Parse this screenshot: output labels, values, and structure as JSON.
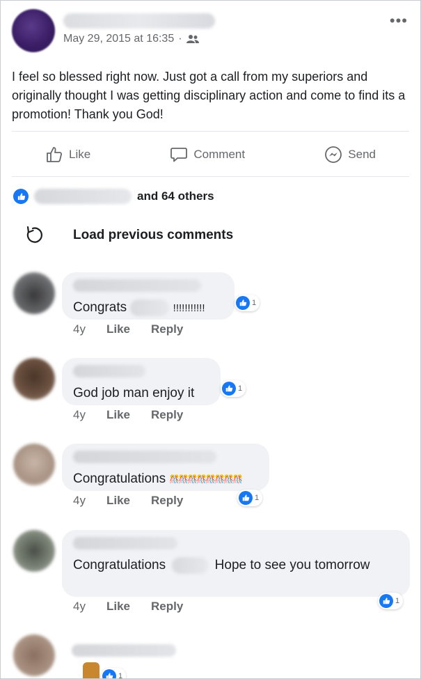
{
  "post": {
    "date": "May 29, 2015 at 16:35",
    "separator": "·",
    "text": "I feel so blessed right now. Just got a call from my superiors and originally thought I was getting disciplinary action and come to find its a promotion! Thank you God!"
  },
  "actions": {
    "like": "Like",
    "comment": "Comment",
    "send": "Send"
  },
  "reactions": {
    "summary": "and 64 others"
  },
  "load_previous": "Load previous comments",
  "comments": [
    {
      "text_before": "Congrats",
      "text_after": "!!!!!!!!!!!",
      "time": "4y",
      "like": "Like",
      "reply": "Reply",
      "reaction_count": "1"
    },
    {
      "text": "God job man enjoy it",
      "time": "4y",
      "like": "Like",
      "reply": "Reply",
      "reaction_count": "1"
    },
    {
      "text": "Congratulations",
      "emoji": "🎊🎊🎊🎊🎊🎊🎊🎊",
      "time": "4y",
      "like": "Like",
      "reply": "Reply",
      "reaction_count": "1"
    },
    {
      "text_before": "Congratulations",
      "text_after": "Hope to see you tomorrow",
      "time": "4y",
      "like": "Like",
      "reply": "Reply",
      "reaction_count": "1"
    },
    {
      "reaction_count": "1"
    }
  ],
  "colors": {
    "accent": "#1877f2",
    "bubble": "#f0f2f5",
    "muted": "#65676b"
  },
  "icons": [
    "people-icon",
    "more-icon",
    "like-icon",
    "comment-icon",
    "messenger-icon",
    "reload-icon",
    "thumbs-up-badge-icon"
  ]
}
